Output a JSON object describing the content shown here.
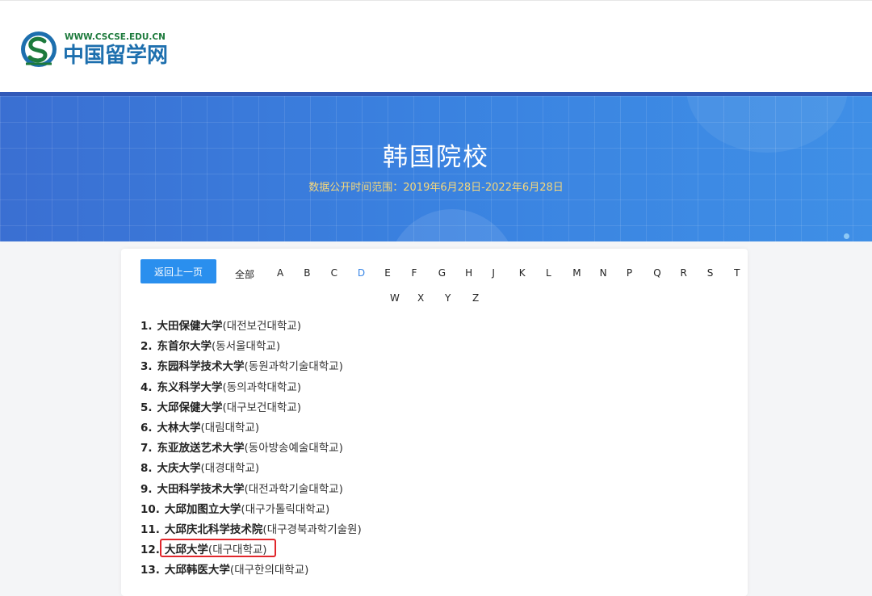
{
  "logo": {
    "url_text": "WWW.CSCSE.EDU.CN",
    "name": "中国留学网"
  },
  "banner": {
    "title": "韩国院校",
    "subtitle": "数据公开时间范围：2019年6月28日-2022年6月28日"
  },
  "nav": {
    "back_label": "返回上一页",
    "all_label": "全部",
    "letters_row1": [
      "A",
      "B",
      "C",
      "D",
      "E",
      "F",
      "G",
      "H",
      "J",
      "K",
      "L",
      "M",
      "N",
      "P",
      "Q",
      "R",
      "S",
      "T"
    ],
    "letters_row2": [
      "W",
      "X",
      "Y",
      "Z"
    ],
    "active_letter": "D"
  },
  "schools": [
    {
      "num": "1.",
      "cn": "大田保健大学",
      "kr": "(대전보건대학교)"
    },
    {
      "num": "2.",
      "cn": "东首尔大学",
      "kr": "(동서울대학교)"
    },
    {
      "num": "3.",
      "cn": "东园科学技术大学",
      "kr": "(동원과학기술대학교)"
    },
    {
      "num": "4.",
      "cn": "东义科学大学",
      "kr": "(동의과학대학교)"
    },
    {
      "num": "5.",
      "cn": "大邱保健大学",
      "kr": "(대구보건대학교)"
    },
    {
      "num": "6.",
      "cn": "大林大学",
      "kr": "(대림대학교)"
    },
    {
      "num": "7.",
      "cn": "东亚放送艺术大学",
      "kr": "(동아방송예술대학교)"
    },
    {
      "num": "8.",
      "cn": "大庆大学",
      "kr": "(대경대학교)"
    },
    {
      "num": "9.",
      "cn": "大田科学技术大学",
      "kr": "(대전과학기술대학교)"
    },
    {
      "num": "10.",
      "cn": "大邱加图立大学",
      "kr": "(대구가톨릭대학교)"
    },
    {
      "num": "11.",
      "cn": "大邱庆北科学技术院",
      "kr": "(대구경북과학기술원)"
    },
    {
      "num": "12.",
      "cn": "大邱大学",
      "kr": "(대구대학교)"
    },
    {
      "num": "13.",
      "cn": "大邱韩医大学",
      "kr": "(대구한의대학교)"
    }
  ],
  "colors": {
    "accent": "#2a8fee",
    "active_letter": "#3a86e6",
    "highlight_border": "#e0262b",
    "banner_subtitle": "#f7d87a",
    "logo_green": "#1d7a3c"
  }
}
